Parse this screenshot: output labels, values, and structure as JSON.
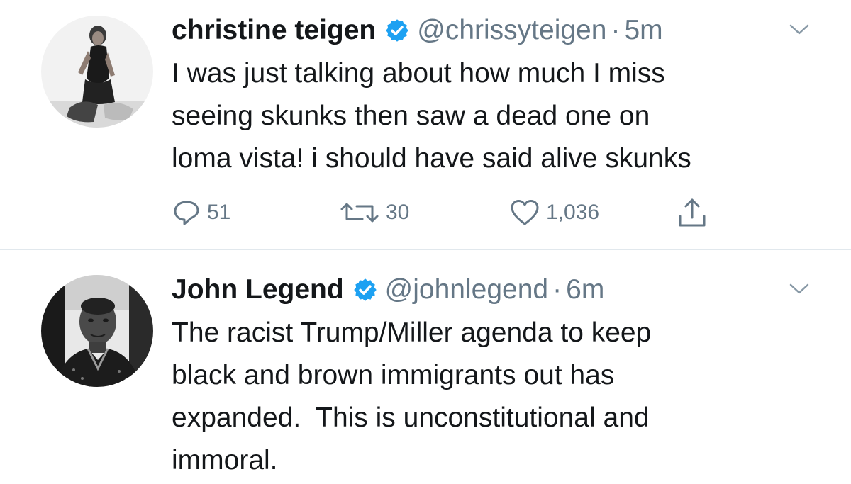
{
  "tweets": [
    {
      "display_name": "christine teigen",
      "handle": "@chrissyteigen",
      "separator": "·",
      "time": "5m",
      "text_lines": [
        "I was just talking about how much I miss",
        "seeing skunks then saw a dead one on",
        "loma vista! i should have said alive skunks"
      ],
      "replies": "51",
      "retweets": "30",
      "likes": "1,036",
      "verified": true
    },
    {
      "display_name": "John Legend",
      "handle": "@johnlegend",
      "separator": "·",
      "time": "6m",
      "text_lines": [
        "The racist Trump/Miller agenda to keep",
        "black and brown immigrants out has",
        "expanded.  This is unconstitutional and",
        "immoral."
      ],
      "verified": true
    }
  ],
  "colors": {
    "primary_text": "#14171a",
    "secondary_text": "#657786",
    "verified_blue": "#1da1f2",
    "divider": "#e1e8ed"
  },
  "icons": {
    "verified": "verified-badge-icon",
    "menu": "chevron-down-icon",
    "reply": "reply-icon",
    "retweet": "retweet-icon",
    "like": "heart-icon",
    "share": "share-icon"
  }
}
